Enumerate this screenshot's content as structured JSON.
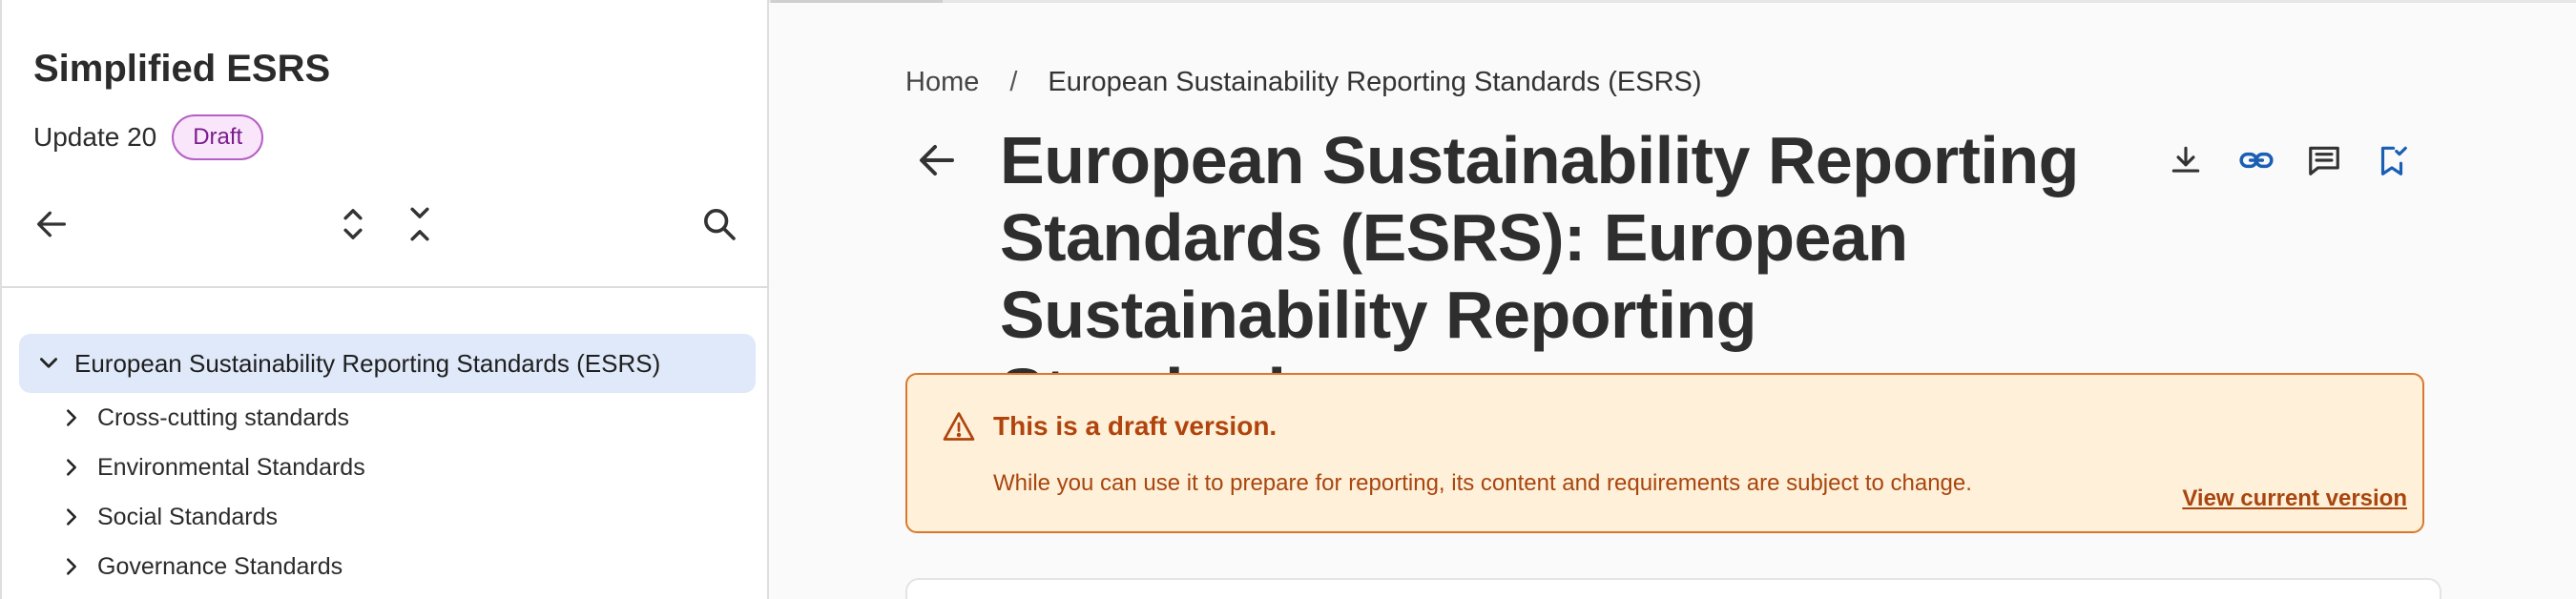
{
  "sidebar": {
    "title": "Simplified ESRS",
    "version": "Update 20",
    "badge": "Draft",
    "icons": {
      "back": "arrow-left-icon",
      "expand_all": "expand-all-icon",
      "collapse_all": "collapse-all-icon",
      "search": "search-icon"
    },
    "tree": {
      "root": "European Sustainability Reporting Standards (ESRS)",
      "items": [
        {
          "label": "Cross-cutting standards"
        },
        {
          "label": "Environmental Standards"
        },
        {
          "label": "Social Standards"
        },
        {
          "label": "Governance Standards"
        }
      ]
    }
  },
  "main": {
    "breadcrumb": {
      "home": "Home",
      "separator": "/",
      "current": "European Sustainability Reporting Standards (ESRS)"
    },
    "title": "European Sustainability Reporting Standards (ESRS): European Sustainability Reporting Standards",
    "actions": [
      "download-icon",
      "link-icon",
      "comment-icon",
      "bookmark-check-icon"
    ],
    "alert": {
      "title": "This is a draft version.",
      "body": "While you can use it to prepare for reporting, its content and requirements are subject to change.",
      "link": "View current version"
    }
  },
  "colors": {
    "tree_selected_bg": "#dfe9f9",
    "badge_bg": "#f9e6fb",
    "badge_border": "#b65fc4",
    "alert_bg": "#fff0d9",
    "alert_border": "#d9782c",
    "alert_text": "#b0440c",
    "link_icon_color": "#1a5fb4"
  }
}
